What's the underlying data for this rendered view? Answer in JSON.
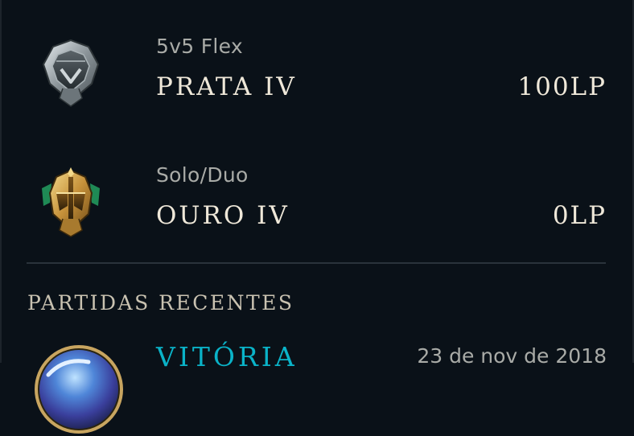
{
  "ranked": [
    {
      "queue": "5v5 Flex",
      "tier": "PRATA IV",
      "lp": "100LP",
      "emblem_icon": "silver-emblem-icon"
    },
    {
      "queue": "Solo/Duo",
      "tier": "OURO IV",
      "lp": "0LP",
      "emblem_icon": "gold-emblem-icon"
    }
  ],
  "recent_matches": {
    "title": "PARTIDAS RECENTES",
    "items": [
      {
        "result": "VITÓRIA",
        "date": "23 de nov de 2018",
        "champion_icon": "champion-avatar-icon"
      }
    ]
  },
  "colors": {
    "background": "#0a1118",
    "primary_text": "#efe8d9",
    "secondary_text": "#a9aba7",
    "victory": "#0ab3c8",
    "divider": "#2a333b"
  }
}
